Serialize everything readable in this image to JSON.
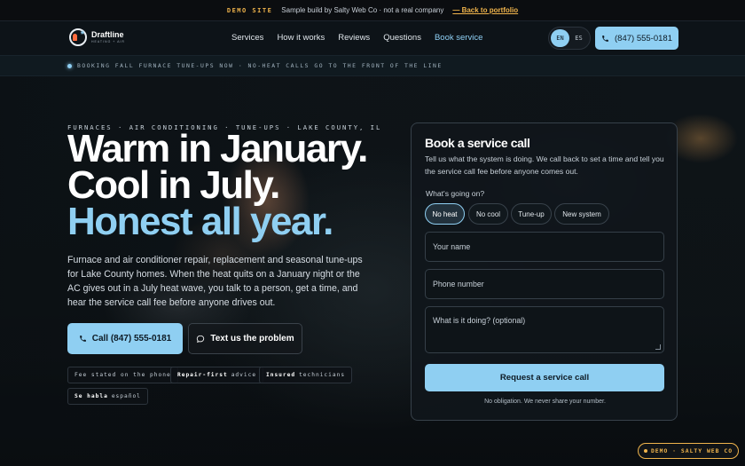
{
  "demo_bar": {
    "tag": "DEMO SITE",
    "text": "Sample build by Salty Web Co · not a real company",
    "link": "— Back to portfolio"
  },
  "brand": {
    "name": "Draftline",
    "sub": "HEATING + AIR"
  },
  "nav": {
    "links": [
      "Services",
      "How it works",
      "Reviews",
      "Questions",
      "Book service"
    ],
    "lang_en": "EN",
    "lang_es": "ES",
    "phone": "(847) 555-0181"
  },
  "ticker": "BOOKING FALL FURNACE TUNE-UPS NOW · NO-HEAT CALLS GO TO THE FRONT OF THE LINE",
  "hero": {
    "eyebrow": "FURNACES · AIR CONDITIONING · TUNE-UPS · LAKE COUNTY, IL",
    "line1": "Warm in January.",
    "line2": "Cool in July.",
    "line3": "Honest all year.",
    "lede": "Furnace and air conditioner repair, replacement and seasonal tune-ups for Lake County homes. When the heat quits on a January night or the AC gives out in a July heat wave, you talk to a person, get a time, and hear the service call fee before anyone drives out.",
    "cta_call": "Call (847) 555-0181",
    "cta_text": "Text us the problem",
    "chips": [
      {
        "bold": "",
        "text": "Fee stated on the phone"
      },
      {
        "bold": "Repair-first",
        "text": "advice"
      },
      {
        "bold": "Insured",
        "text": "technicians"
      },
      {
        "bold": "Se habla",
        "text": "español"
      }
    ]
  },
  "form": {
    "title": "Book a service call",
    "desc": "Tell us what the system is doing. We call back to set a time and tell you the service call fee before anyone comes out.",
    "question": "What's going on?",
    "options": [
      "No heat",
      "No cool",
      "Tune-up",
      "New system"
    ],
    "selected": "No heat",
    "name_placeholder": "Your name",
    "phone_placeholder": "Phone number",
    "details_placeholder": "What is it doing? (optional)",
    "submit": "Request a service call",
    "note": "No obligation. We never share your number."
  },
  "badge": "DEMO · SALTY WEB CO",
  "colors": {
    "accent": "#8fcff2",
    "demo": "#f0b44c",
    "background": "#0b0f14"
  }
}
